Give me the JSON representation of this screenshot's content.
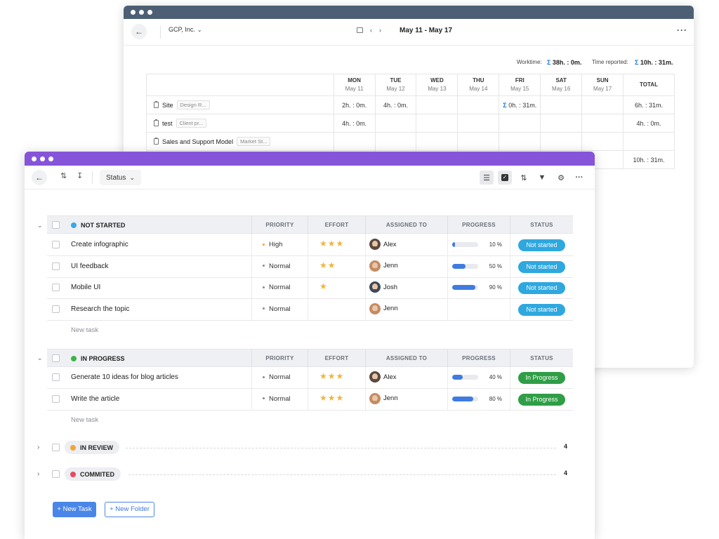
{
  "timesheet": {
    "company": "GCP, Inc.",
    "date_range": "May 11 - May 17",
    "worktime_label": "Worktime:",
    "worktime_value": "38h. : 0m.",
    "time_reported_label": "Time reported:",
    "time_reported_value": "10h. : 31m.",
    "days": [
      {
        "day": "MON",
        "date": "May 11"
      },
      {
        "day": "TUE",
        "date": "May 12"
      },
      {
        "day": "WED",
        "date": "May 13"
      },
      {
        "day": "THU",
        "date": "May 14"
      },
      {
        "day": "FRI",
        "date": "May 15"
      },
      {
        "day": "SAT",
        "date": "May 16"
      },
      {
        "day": "SUN",
        "date": "May 17"
      }
    ],
    "total_header": "TOTAL",
    "rows": [
      {
        "name": "Site",
        "tag": "Design R...",
        "mon": "2h. : 0m.",
        "tue": "4h. : 0m.",
        "fri": "0h. : 31m.",
        "total": "6h. : 31m."
      },
      {
        "name": "test",
        "tag": "Client pr...",
        "mon": "4h. : 0m.",
        "total": "4h. : 0m."
      },
      {
        "name": "Sales and Support Model",
        "tag": "Market St..."
      }
    ],
    "grand_total": "10h. : 31m."
  },
  "toolbar": {
    "status_label": "Status"
  },
  "groups": [
    {
      "title": "NOT STARTED",
      "color": "#3aa7e8",
      "columns": [
        "PRIORITY",
        "EFFORT",
        "ASSIGNED TO",
        "PROGRESS",
        "STATUS"
      ],
      "tasks": [
        {
          "name": "Create infographic",
          "priority": "High",
          "priority_color": "#f39a3a",
          "stars": "★★★",
          "assignee": "Alex",
          "progress": 10,
          "progress_label": "10 %",
          "status": "Not started",
          "status_color": "#2ea8df"
        },
        {
          "name": "UI feedback",
          "priority": "Normal",
          "priority_color": "#888888",
          "stars": "★★",
          "assignee": "Jenn",
          "progress": 50,
          "progress_label": "50 %",
          "status": "Not started",
          "status_color": "#2ea8df"
        },
        {
          "name": "Mobile UI",
          "priority": "Normal",
          "priority_color": "#888888",
          "stars": "★",
          "assignee": "Josh",
          "progress": 90,
          "progress_label": "90 %",
          "status": "Not started",
          "status_color": "#2ea8df"
        },
        {
          "name": "Research the topic",
          "priority": "Normal",
          "priority_color": "#888888",
          "stars": "",
          "assignee": "Jenn",
          "progress": null,
          "progress_label": "",
          "status": "Not started",
          "status_color": "#2ea8df"
        }
      ],
      "new_task_label": "New task"
    },
    {
      "title": "IN PROGRESS",
      "color": "#3db54a",
      "columns": [
        "PRIORITY",
        "EFFORT",
        "ASSIGNED TO",
        "PROGRESS",
        "STATUS"
      ],
      "tasks": [
        {
          "name": "Generate 10 ideas for blog articles",
          "priority": "Normal",
          "priority_color": "#888888",
          "stars": "★★★",
          "assignee": "Alex",
          "progress": 40,
          "progress_label": "40 %",
          "status": "In Progress",
          "status_color": "#2f9e47"
        },
        {
          "name": "Write the article",
          "priority": "Normal",
          "priority_color": "#888888",
          "stars": "★★★",
          "assignee": "Jenn",
          "progress": 80,
          "progress_label": "80 %",
          "status": "In Progress",
          "status_color": "#2f9e47"
        }
      ],
      "new_task_label": "New task"
    }
  ],
  "collapsed_groups": [
    {
      "title": "IN REVIEW",
      "color": "#f0a63a",
      "count": "4"
    },
    {
      "title": "COMMITED",
      "color": "#e84a5f",
      "count": "4"
    }
  ],
  "actions": {
    "new_task": "+ New Task",
    "new_folder": "+ New Folder"
  }
}
